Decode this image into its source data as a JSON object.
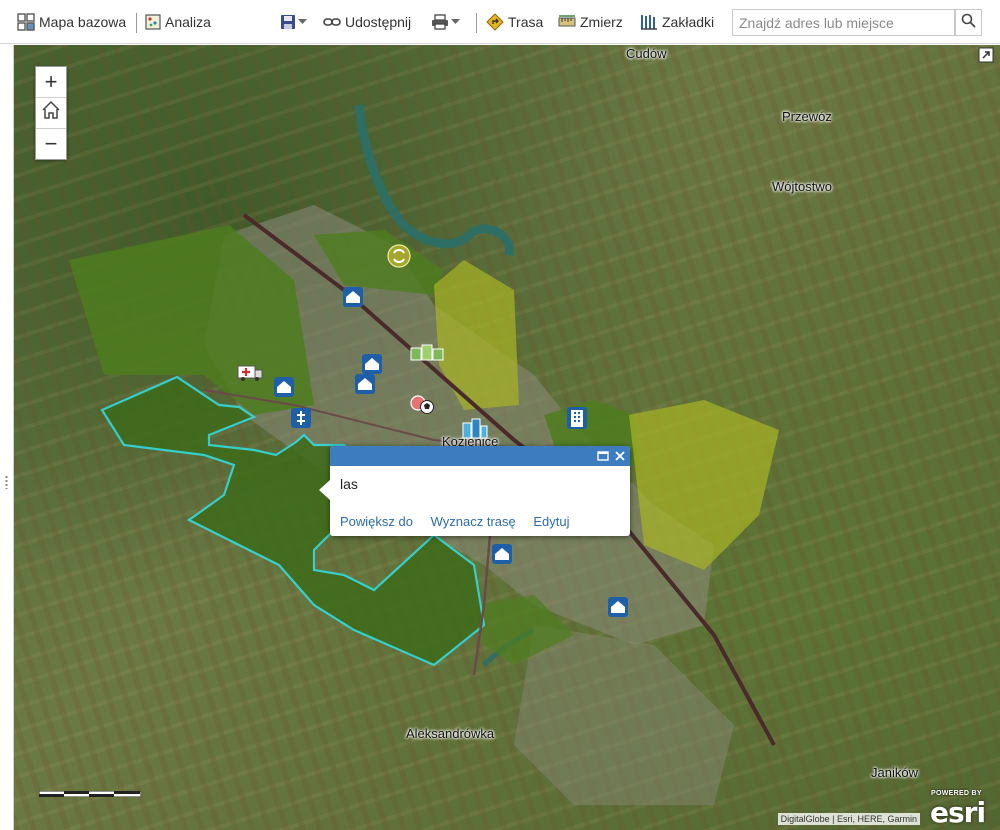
{
  "toolbar": {
    "basemap_label": "Mapa bazowa",
    "analysis_label": "Analiza",
    "share_label": "Udostępnij",
    "route_label": "Trasa",
    "measure_label": "Zmierz",
    "bookmarks_label": "Zakładki",
    "search_placeholder": "Znajdź adres lub miejsce"
  },
  "map": {
    "place_labels": [
      "Cudów",
      "Przewóz",
      "Wójtostwo",
      "Kozienice",
      "Aleksandrówka",
      "Janików"
    ],
    "attribution": "DigitalGlobe | Esri, HERE, Garmin",
    "powered_by": "POWERED BY",
    "esri_logo": "esri",
    "zoom_in": "+",
    "zoom_out": "−",
    "icons": [
      "zoom-in-icon",
      "home-icon",
      "zoom-out-icon",
      "expand-icon",
      "school-icon",
      "church-icon",
      "ambulance-icon",
      "sports-icon",
      "building-icon",
      "recycle-icon"
    ]
  },
  "popup": {
    "title": "las",
    "actions": [
      "Powiększ do",
      "Wyznacz trasę",
      "Edytuj"
    ]
  },
  "colors": {
    "accent": "#3c7cbf",
    "link": "#2d6cad",
    "selection_outline": "#2fe0e6",
    "poi_blue": "#1f5fa8"
  }
}
